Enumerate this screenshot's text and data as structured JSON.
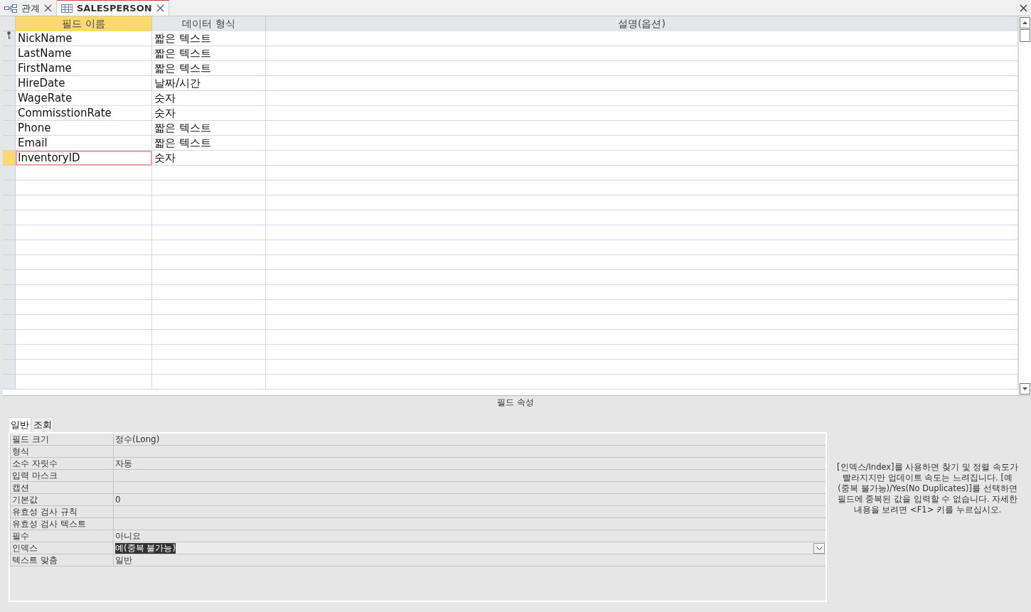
{
  "tabs": [
    {
      "label": "관계",
      "kind": "relationships",
      "selected": false
    },
    {
      "label": "SALESPERSON",
      "kind": "table",
      "selected": true
    }
  ],
  "grid": {
    "columns": [
      "필드 이름",
      "데이터 형식",
      "설명(옵션)"
    ],
    "rows": [
      {
        "name": "NickName",
        "type": "짧은 텍스트",
        "primary_key": true,
        "selected": false
      },
      {
        "name": "LastName",
        "type": "짧은 텍스트",
        "primary_key": false,
        "selected": false
      },
      {
        "name": "FirstName",
        "type": "짧은 텍스트",
        "primary_key": false,
        "selected": false
      },
      {
        "name": "HireDate",
        "type": "날짜/시간",
        "primary_key": false,
        "selected": false
      },
      {
        "name": "WageRate",
        "type": "숫자",
        "primary_key": false,
        "selected": false
      },
      {
        "name": "CommisstionRate",
        "type": "숫자",
        "primary_key": false,
        "selected": false
      },
      {
        "name": "Phone",
        "type": "짧은 텍스트",
        "primary_key": false,
        "selected": false
      },
      {
        "name": "Email",
        "type": "짧은 텍스트",
        "primary_key": false,
        "selected": false
      },
      {
        "name": "InventoryID",
        "type": "숫자",
        "primary_key": false,
        "selected": true
      }
    ]
  },
  "properties": {
    "title": "필드 속성",
    "tabs": [
      {
        "label": "일반",
        "selected": true
      },
      {
        "label": "조회",
        "selected": false
      }
    ],
    "rows": [
      {
        "label": "필드 크기",
        "value": "정수(Long)",
        "active": false
      },
      {
        "label": "형식",
        "active": false
      },
      {
        "label": "소수 자릿수",
        "value": "자동",
        "active": false
      },
      {
        "label": "입력 마스크",
        "active": false
      },
      {
        "label": "캡션",
        "active": false
      },
      {
        "label": "기본값",
        "value": "0",
        "active": false
      },
      {
        "label": "유효성 검사 규칙",
        "active": false
      },
      {
        "label": "유효성 검사 텍스트",
        "active": false
      },
      {
        "label": "필수",
        "value": "아니요",
        "active": false
      },
      {
        "label": "인덱스",
        "value": "예(중복 불가능)",
        "active": true
      },
      {
        "label": "텍스트 맞춤",
        "value": "일반",
        "active": false
      }
    ],
    "help": "[인덱스/Index]를 사용하면 찾기 및 정렬 속도가 빨라지지만 업데이트 속도는 느려집니다. [예(중복 불가능)/Yes(No Duplicates)]를 선택하면 필드에 중복된 값을 입력할 수 없습니다. 자세한 내용을 보려면 <F1> 키를 누르십시오."
  }
}
